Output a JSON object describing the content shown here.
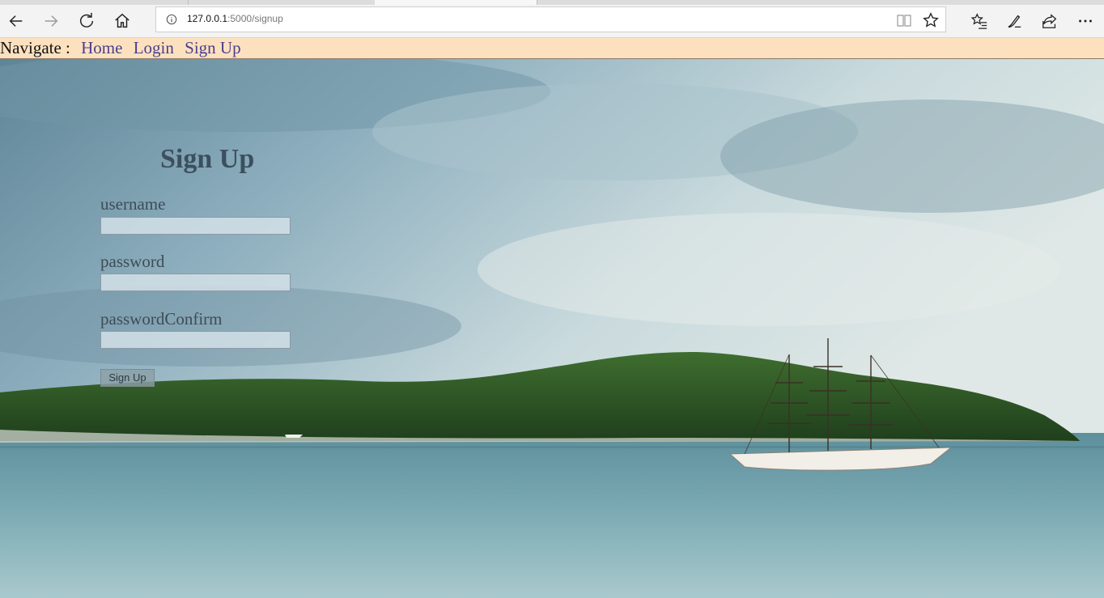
{
  "browser": {
    "url_host": "127.0.0.1",
    "url_rest": ":5000/signup",
    "toolbar_icons": [
      "back-icon",
      "forward-icon",
      "refresh-icon",
      "home-icon",
      "info-icon",
      "reading-view-icon",
      "favorite-star-icon",
      "favorites-list-icon",
      "pen-icon",
      "share-icon",
      "more-icon"
    ]
  },
  "nav": {
    "label": "Navigate :",
    "links": [
      "Home",
      "Login",
      "Sign Up"
    ]
  },
  "form": {
    "title": "Sign Up",
    "username_label": "username",
    "password_label": "password",
    "confirm_label": "passwordConfirm",
    "submit_label": "Sign Up"
  },
  "colors": {
    "nav_bg": "#fde1bf",
    "link": "#4a3f8c",
    "sky": "#8fb0bf",
    "sea": "#6fa0ab",
    "island": "#2f5a26"
  }
}
